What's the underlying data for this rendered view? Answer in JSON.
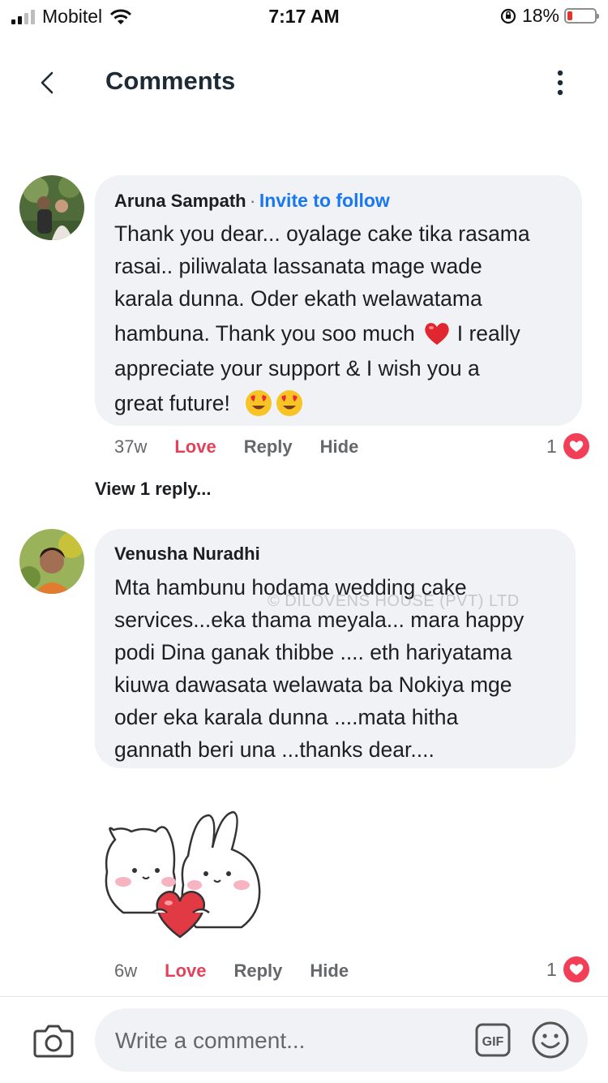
{
  "status_bar": {
    "carrier": "Mobitel",
    "time": "7:17 AM",
    "battery": "18%"
  },
  "header": {
    "title": "Comments"
  },
  "comments": [
    {
      "author": "Aruna Sampath",
      "separator": "·",
      "invite": "Invite to follow",
      "lines": [
        "Thank you dear... oyalage cake tika rasama",
        "rasai.. piliwalata lassanata mage wade",
        "karala dunna. Oder ekath welawatama",
        "hambuna. Thank you soo much",
        "I really",
        "appreciate your support & I wish you a",
        "great future!"
      ],
      "age": "37w",
      "love": "Love",
      "reply": "Reply",
      "hide": "Hide",
      "reaction_count": "1"
    },
    {
      "author": "Venusha Nuradhi",
      "lines": [
        "Mta hambunu hodama wedding cake",
        "services...eka thama meyala... mara happy",
        "podi Dina ganak thibbe .... eth hariyatama",
        "kiuwa dawasata welawata ba Nokiya mge",
        "oder eka karala dunna ....mata hitha",
        "gannath beri una ...thanks dear...."
      ],
      "age": "6w",
      "love": "Love",
      "reply": "Reply",
      "hide": "Hide",
      "reaction_count": "1"
    }
  ],
  "view_replies": "View 1 reply...",
  "watermark": "© DILOVENS HOUSE (PVT) LTD",
  "composer": {
    "placeholder": "Write a comment...",
    "gif_label": "GIF"
  },
  "colors": {
    "link": "#1877f2",
    "love": "#e0435a",
    "bubble": "#f0f2f5",
    "heart": "#f33e58"
  },
  "icons": [
    "back-arrow-icon",
    "more-vertical-icon",
    "heart-reaction-icon",
    "red-heart-emoji",
    "heart-eyes-emoji",
    "camera-icon",
    "gif-icon",
    "smiley-icon"
  ]
}
